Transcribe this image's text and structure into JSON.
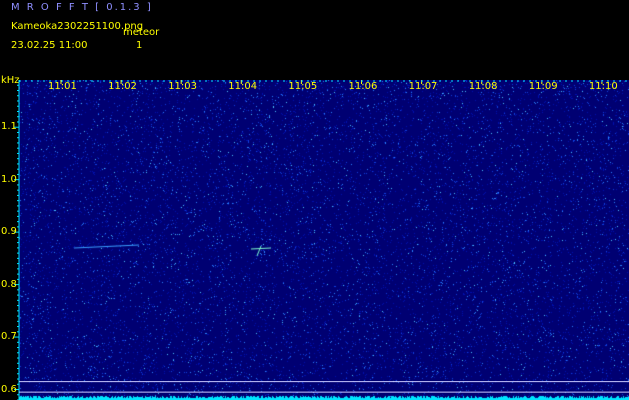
{
  "header": {
    "app_title": "M R O F F T [ 0.1.3 ]",
    "file_name": "Kameoka2302251100.png",
    "meteor_label": "meteor",
    "datetime": "23.02.25  11:00",
    "meteor_count": "1"
  },
  "spectrogram": {
    "y_unit": "kHz",
    "time_ticks": [
      "11:01",
      "11:02",
      "11:03",
      "11:04",
      "11:05",
      "11:06",
      "11:07",
      "11:08",
      "11:09",
      "11:10"
    ],
    "freq_ticks": [
      "1.1",
      "1.0",
      "0.9",
      "0.8",
      "0.7",
      "0.6"
    ],
    "freq_values": [
      1.1,
      1.0,
      0.9,
      0.8,
      0.7,
      0.6
    ],
    "freq_range": [
      0.58,
      1.19
    ],
    "marker_freqs": [
      0.615,
      0.595
    ],
    "colors": {
      "background": "#000072",
      "noise": "#4fc8ff",
      "axis": "#ffff00",
      "floor": "#00e5ff",
      "marker": "#c8c8ff"
    }
  }
}
